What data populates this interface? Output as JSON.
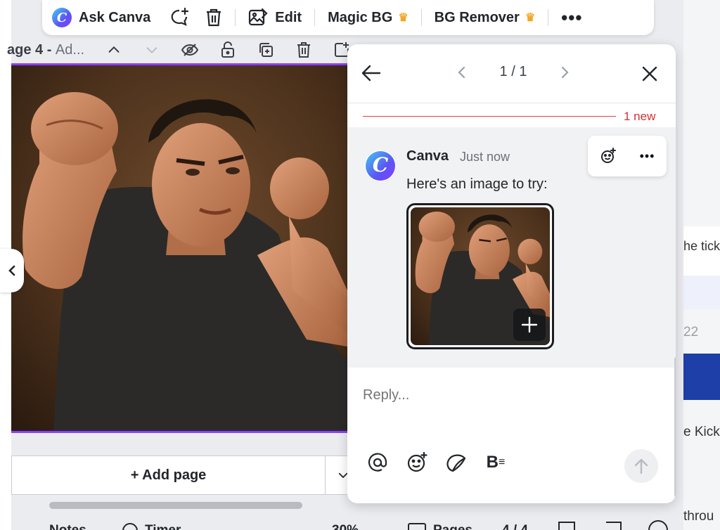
{
  "toolbar": {
    "ask_canva": "Ask Canva",
    "edit": "Edit",
    "magic_bg": "Magic BG",
    "bg_remover": "BG Remover"
  },
  "page_header": {
    "title": "age 4 - ",
    "subtitle": "Ad..."
  },
  "add_page": {
    "label": "+ Add page"
  },
  "bottom_bar": {
    "notes": "Notes",
    "timer": "Timer",
    "zoom": "30%",
    "pages": "Pages",
    "page_count": "4 / 4"
  },
  "comment_panel": {
    "pager": {
      "current": "1 / 1"
    },
    "new_label": "1 new",
    "message": {
      "author": "Canva",
      "avatar_letter": "C",
      "time": "Just now",
      "text": "Here's an image to try:"
    },
    "reply_placeholder": "Reply..."
  },
  "background_app": {
    "line1": "he tick",
    "line2": "22",
    "line3": "e Kick",
    "line4": "throu"
  },
  "colors": {
    "accent": "#8b3dff",
    "new_indicator": "#e33e3e",
    "crown": "#f5a623"
  }
}
